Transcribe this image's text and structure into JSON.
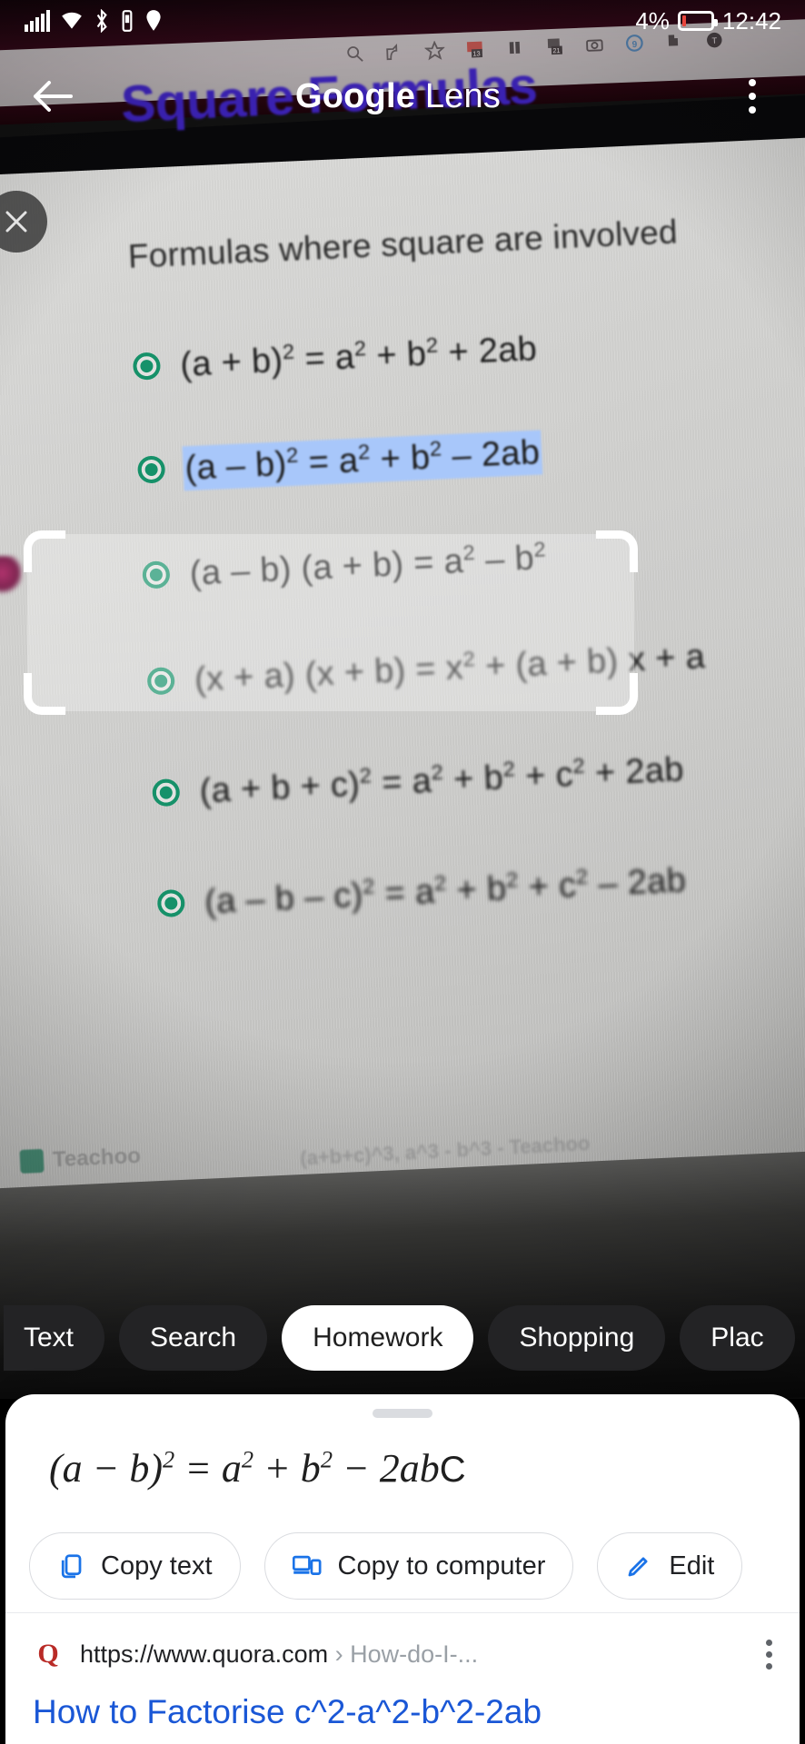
{
  "status_bar": {
    "battery_percent": "4%",
    "time": "12:42",
    "icons": [
      "signal-icon",
      "wifi-icon",
      "bluetooth-icon",
      "vibrate-icon",
      "location-icon"
    ]
  },
  "app_bar": {
    "back_icon": "back-arrow-icon",
    "title_brand": "Google",
    "title_product": " Lens",
    "overflow_icon": "kebab-menu-icon"
  },
  "viewfinder": {
    "close_icon": "close-icon",
    "document": {
      "title": "Square Formulas",
      "subtitle": "Formulas where square are involved",
      "formulas": [
        "(a + b)² = a² + b² + 2ab",
        "(a − b)² = a² + b² − 2ab",
        "(a − b) (a + b) = a² − b²",
        "(x + a) (x + b) = x² + (a + b) x + a",
        "(a + b + c)² = a² + b² + c² + 2ab",
        "(a − b − c)² = a² + b² + c² − 2ab"
      ],
      "selected_formula_index": 1,
      "watermark": "Teachoo",
      "background_snippet": "(a+b+c)^3, a^3 - b^3 - Teachoo"
    }
  },
  "filter_chips": [
    {
      "label": "Text",
      "selected": false
    },
    {
      "label": "Search",
      "selected": false
    },
    {
      "label": "Homework",
      "selected": true
    },
    {
      "label": "Shopping",
      "selected": false
    },
    {
      "label": "Plac",
      "selected": false
    }
  ],
  "bottom_sheet": {
    "recognized_formula": {
      "lhs_open": "(a − b)",
      "lhs_exp": "2",
      "eq": " = a",
      "a_exp": "2",
      "plus_b": " + b",
      "b_exp": "2",
      "minus": " − 2ab",
      "trailing": "C",
      "full_text": "(a − b)² = a² + b² − 2ab C"
    },
    "actions": [
      {
        "label": "Copy text",
        "icon": "copy-icon"
      },
      {
        "label": "Copy to computer",
        "icon": "devices-icon"
      },
      {
        "label": "Edit",
        "icon": "pencil-icon"
      }
    ],
    "result": {
      "favicon_letter": "Q",
      "url_domain": "https://www.quora.com",
      "url_separator": " › ",
      "url_path": "How-do-I-...",
      "title": "How to Factorise c^2-a^2-b^2-2ab",
      "overflow_icon": "kebab-menu-icon"
    }
  },
  "colors": {
    "doc_title": "#3b22b5",
    "bullet_green": "#15916a",
    "selection_blue": "#a8c7fa",
    "link_blue": "#1a57d6",
    "action_icon_blue": "#1a73e8",
    "battery_red": "#e8453c"
  }
}
